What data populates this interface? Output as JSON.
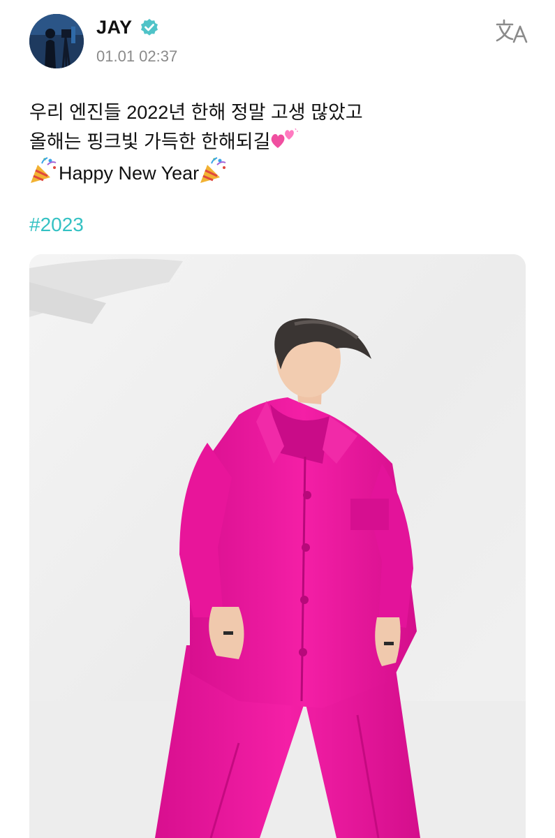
{
  "post": {
    "author": "JAY",
    "verified": true,
    "timestamp": "01.01 02:37",
    "text_line_1": "우리 엔진들 2022년 한해 정말 고생 많았고",
    "text_line_2": "올해는 핑크빛 가득한 한해되길",
    "text_line_3": "Happy New Year",
    "line2_emoji": "pink-hearts",
    "line3_emoji": "party-popper",
    "hashtag": "#2023"
  },
  "icons": {
    "verified": "verified-badge-icon",
    "translate": "translate-icon"
  },
  "colors": {
    "hashtag": "#34c1c3",
    "verified_badge": "#4fc3c8",
    "timestamp": "#8a8a8a",
    "outfit_pink": "#ee1aa0"
  }
}
